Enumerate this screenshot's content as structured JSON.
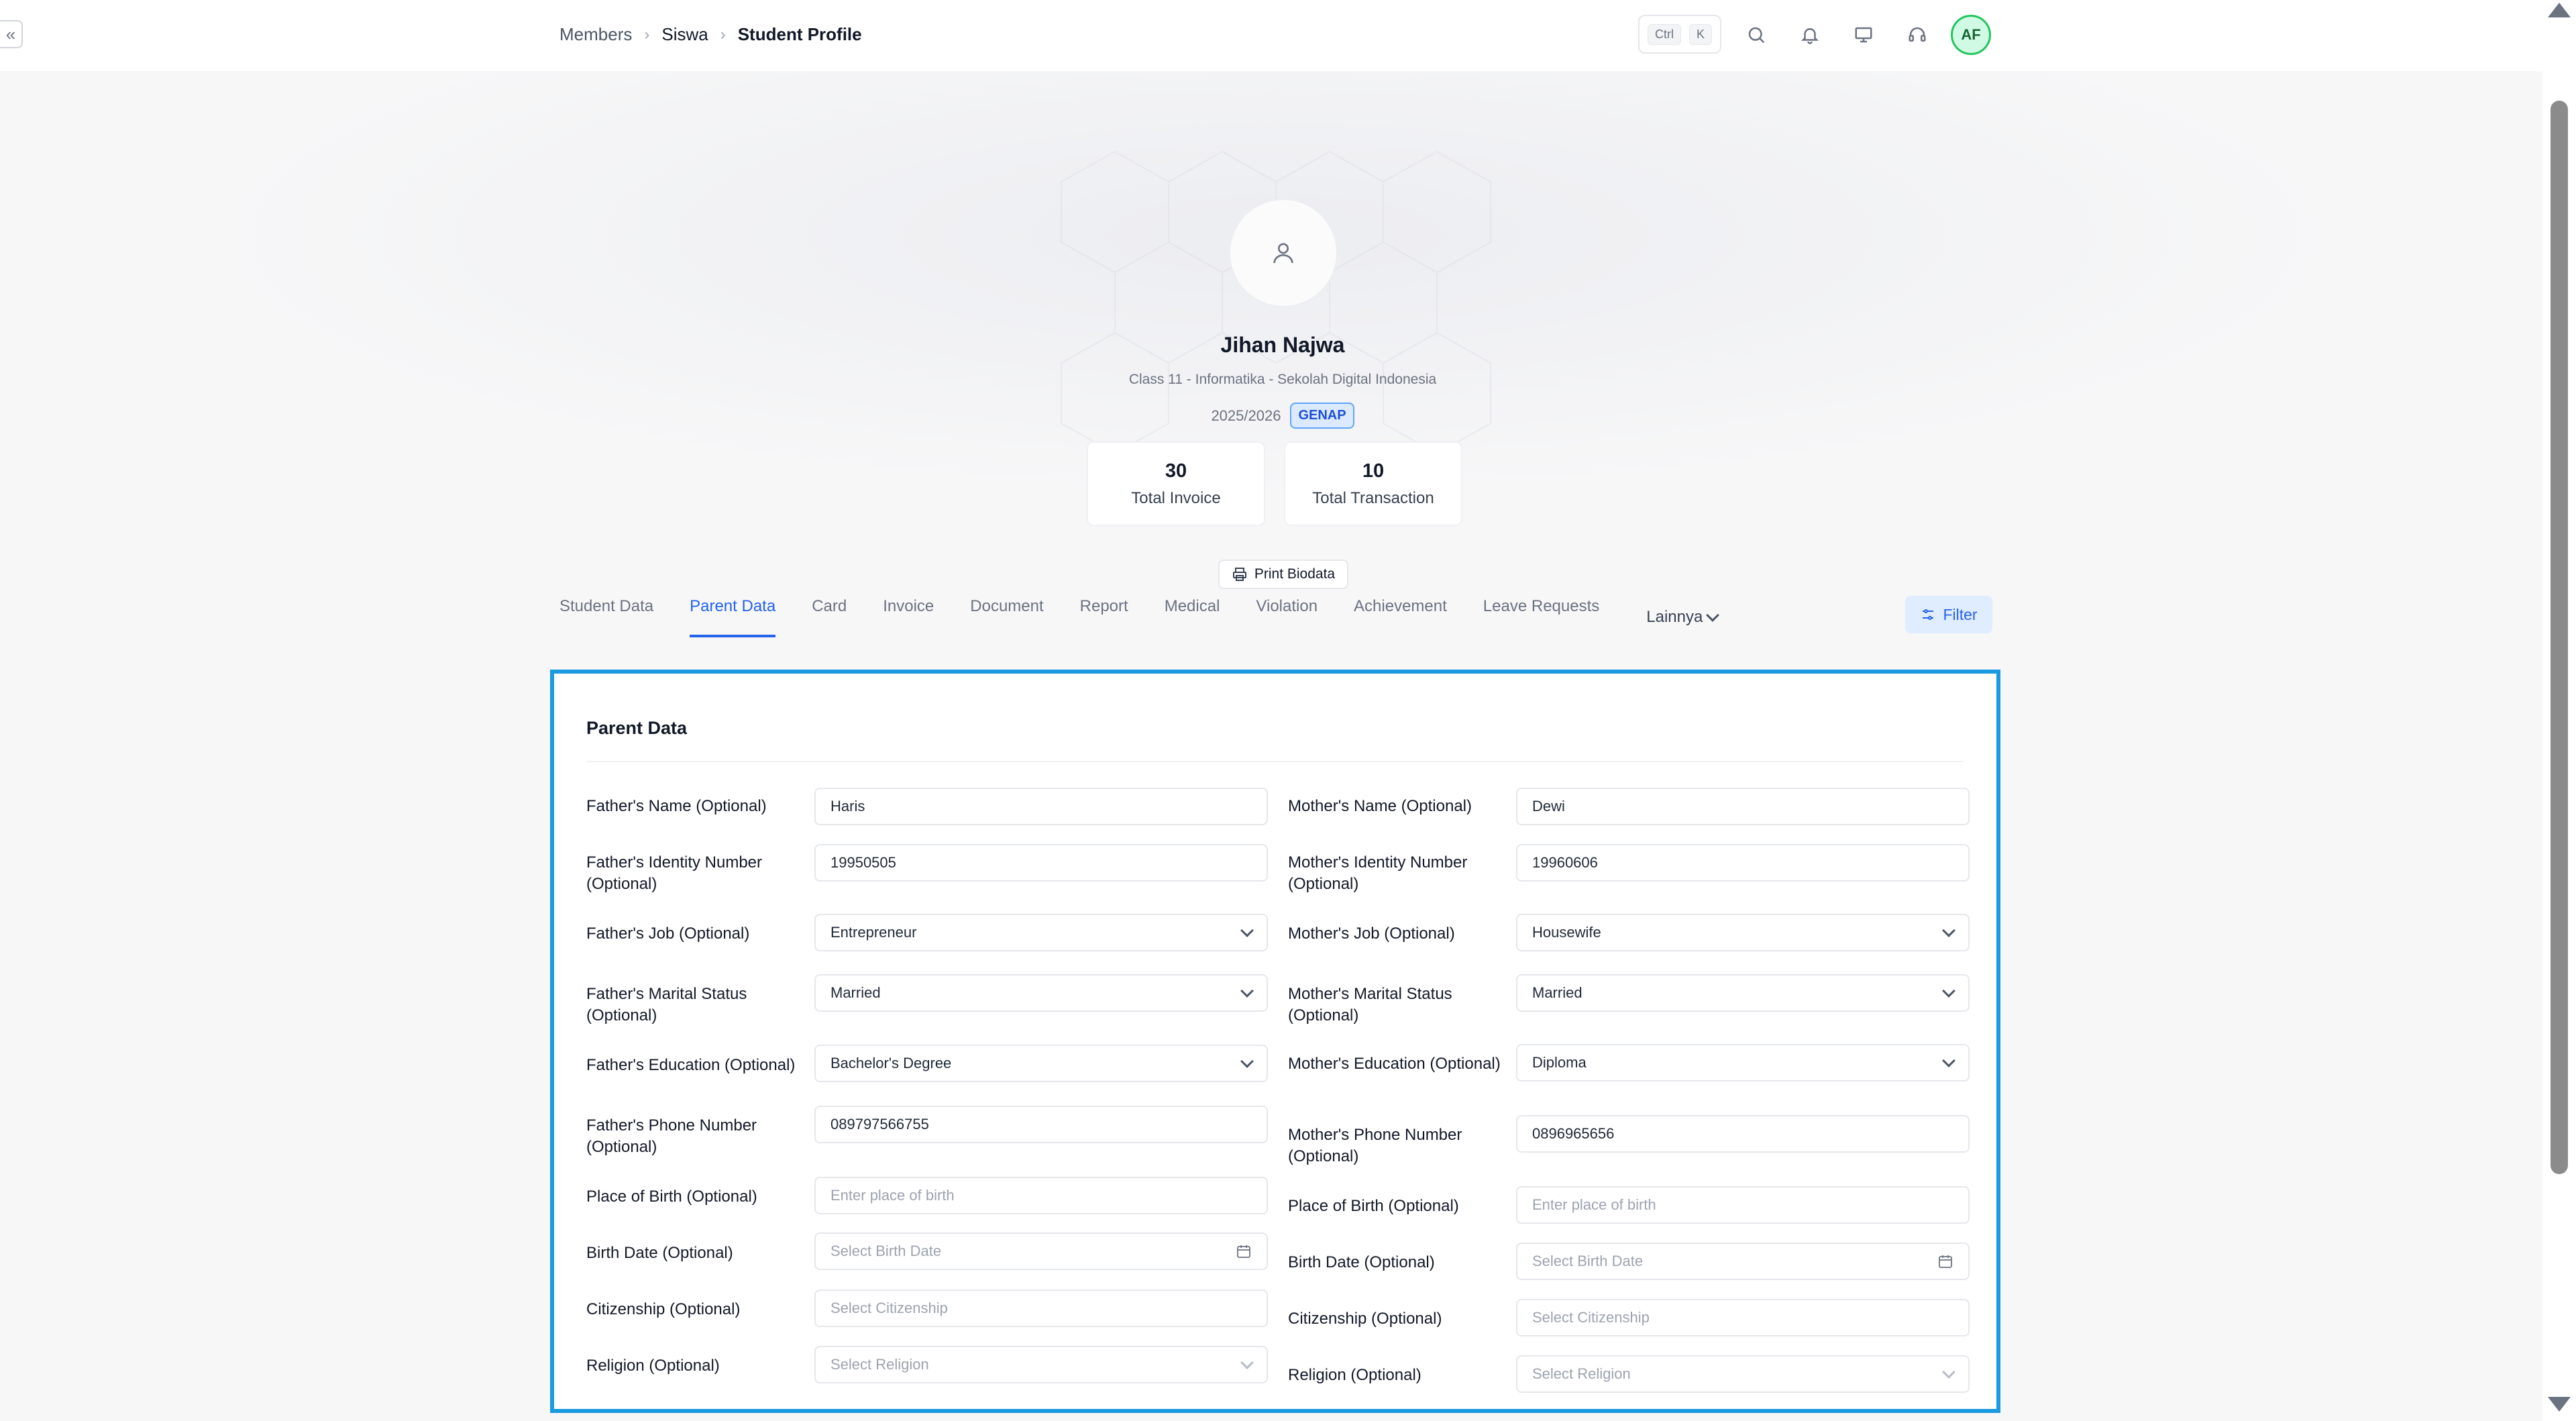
{
  "breadcrumb": {
    "items": [
      "Members",
      "Siswa",
      "Student Profile"
    ]
  },
  "shortcut": {
    "key1": "Ctrl",
    "key2": "K"
  },
  "user": {
    "initials": "AF"
  },
  "profile": {
    "name": "Jihan Najwa",
    "class_info": "Class 11 - Informatika - Sekolah Digital Indonesia",
    "academic_year": "2025/2026",
    "semester": "GENAP",
    "stats": [
      {
        "value": "30",
        "label": "Total Invoice"
      },
      {
        "value": "10",
        "label": "Total Transaction"
      }
    ],
    "print_label": "Print Biodata"
  },
  "tabs": {
    "items": [
      "Student Data",
      "Parent Data",
      "Card",
      "Invoice",
      "Document",
      "Report",
      "Medical",
      "Violation",
      "Achievement",
      "Leave Requests"
    ],
    "active": "Parent Data",
    "more_label": "Lainnya",
    "filter_label": "Filter"
  },
  "parent_data": {
    "title": "Parent Data",
    "father": {
      "name_label": "Father's Name (Optional)",
      "name_value": "Haris",
      "id_label": "Father's Identity Number (Optional)",
      "id_value": "19950505",
      "job_label": "Father's Job (Optional)",
      "job_value": "Entrepreneur",
      "marital_label": "Father's Marital Status (Optional)",
      "marital_value": "Married",
      "education_label": "Father's Education (Optional)",
      "education_value": "Bachelor's Degree",
      "phone_label": "Father's Phone Number (Optional)",
      "phone_value": "089797566755",
      "pob_label": "Place of Birth (Optional)",
      "pob_placeholder": "Enter place of birth",
      "dob_label": "Birth Date (Optional)",
      "dob_placeholder": "Select Birth Date",
      "citizenship_label": "Citizenship (Optional)",
      "citizenship_placeholder": "Select Citizenship",
      "religion_label": "Religion (Optional)",
      "religion_placeholder": "Select Religion"
    },
    "mother": {
      "name_label": "Mother's Name (Optional)",
      "name_value": "Dewi",
      "id_label": "Mother's Identity Number (Optional)",
      "id_value": "19960606",
      "job_label": "Mother's Job (Optional)",
      "job_value": "Housewife",
      "marital_label": "Mother's Marital Status (Optional)",
      "marital_value": "Married",
      "education_label": "Mother's Education (Optional)",
      "education_value": "Diploma",
      "phone_label": "Mother's Phone Number (Optional)",
      "phone_value": "0896965656",
      "pob_label": "Place of Birth (Optional)",
      "pob_placeholder": "Enter place of birth",
      "dob_label": "Birth Date (Optional)",
      "dob_placeholder": "Select Birth Date",
      "citizenship_label": "Citizenship (Optional)",
      "citizenship_placeholder": "Select Citizenship",
      "religion_label": "Religion (Optional)",
      "religion_placeholder": "Select Religion"
    }
  },
  "colors": {
    "accent": "#2563eb",
    "focus_border": "#1a9ae0",
    "avatar_ring": "#22c55e"
  },
  "icons": [
    "collapse-icon",
    "search-icon",
    "bell-icon",
    "monitor-icon",
    "headset-icon",
    "user-icon",
    "printer-icon",
    "filter-icon",
    "chevron-down-icon",
    "calendar-icon"
  ]
}
